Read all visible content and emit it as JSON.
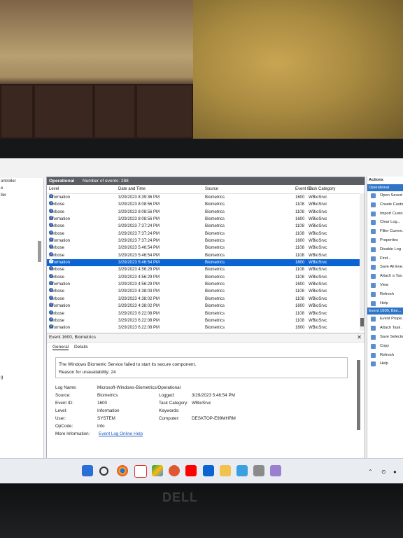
{
  "main": {
    "tab_title": "Operational",
    "event_count": "Number of events: 288",
    "columns": [
      "Level",
      "Date and Time",
      "Source",
      "Event ID",
      "Task Category"
    ],
    "rows": [
      {
        "level": "Information",
        "date": "3/29/2023 8:39:36 PM",
        "source": "Biometrics",
        "id": "1600",
        "cat": "WBioSrvc"
      },
      {
        "level": "Verbose",
        "date": "3/29/2023 8:08:56 PM",
        "source": "Biometrics",
        "id": "1108",
        "cat": "WBioSrvc"
      },
      {
        "level": "Verbose",
        "date": "3/29/2023 8:08:56 PM",
        "source": "Biometrics",
        "id": "1108",
        "cat": "WBioSrvc"
      },
      {
        "level": "Information",
        "date": "3/29/2023 8:08:56 PM",
        "source": "Biometrics",
        "id": "1600",
        "cat": "WBioSrvc"
      },
      {
        "level": "Verbose",
        "date": "3/29/2023 7:37:24 PM",
        "source": "Biometrics",
        "id": "1108",
        "cat": "WBioSrvc"
      },
      {
        "level": "Verbose",
        "date": "3/29/2023 7:37:24 PM",
        "source": "Biometrics",
        "id": "1108",
        "cat": "WBioSrvc"
      },
      {
        "level": "Information",
        "date": "3/29/2023 7:37:24 PM",
        "source": "Biometrics",
        "id": "1600",
        "cat": "WBioSrvc"
      },
      {
        "level": "Verbose",
        "date": "3/29/2023 5:46:54 PM",
        "source": "Biometrics",
        "id": "1108",
        "cat": "WBioSrvc"
      },
      {
        "level": "Verbose",
        "date": "3/29/2023 5:46:54 PM",
        "source": "Biometrics",
        "id": "1108",
        "cat": "WBioSrvc"
      },
      {
        "level": "Information",
        "date": "3/29/2023 5:46:54 PM",
        "source": "Biometrics",
        "id": "1600",
        "cat": "WBioSrvc"
      },
      {
        "level": "Verbose",
        "date": "3/29/2023 4:56:29 PM",
        "source": "Biometrics",
        "id": "1108",
        "cat": "WBioSrvc"
      },
      {
        "level": "Verbose",
        "date": "3/29/2023 4:56:29 PM",
        "source": "Biometrics",
        "id": "1108",
        "cat": "WBioSrvc"
      },
      {
        "level": "Information",
        "date": "3/29/2023 4:56:29 PM",
        "source": "Biometrics",
        "id": "1600",
        "cat": "WBioSrvc"
      },
      {
        "level": "Verbose",
        "date": "3/29/2023 4:38:03 PM",
        "source": "Biometrics",
        "id": "1108",
        "cat": "WBioSrvc"
      },
      {
        "level": "Verbose",
        "date": "3/29/2023 4:38:02 PM",
        "source": "Biometrics",
        "id": "1108",
        "cat": "WBioSrvc"
      },
      {
        "level": "Information",
        "date": "3/29/2023 4:38:02 PM",
        "source": "Biometrics",
        "id": "1600",
        "cat": "WBioSrvc"
      },
      {
        "level": "Verbose",
        "date": "3/29/2023 6:22:08 PM",
        "source": "Biometrics",
        "id": "1108",
        "cat": "WBioSrvc"
      },
      {
        "level": "Verbose",
        "date": "3/29/2023 6:22:08 PM",
        "source": "Biometrics",
        "id": "1108",
        "cat": "WBioSrvc"
      },
      {
        "level": "Information",
        "date": "3/29/2023 6:22:08 PM",
        "source": "Biometrics",
        "id": "1600",
        "cat": "WBioSrvc"
      }
    ],
    "selected_index": 9
  },
  "left_nav": [
    "ontroller",
    "e",
    "ller"
  ],
  "detail": {
    "title": "Event 1600, Biometrics",
    "tabs": [
      "General",
      "Details"
    ],
    "message": "The Windows Biometric Service failed to start its secure component.",
    "reason": "Reason for unavailability: 24",
    "props": {
      "log_name_label": "Log Name:",
      "log_name": "Microsoft-Windows-Biometrics/Operational",
      "source_label": "Source:",
      "source": "Biometrics",
      "logged_label": "Logged:",
      "logged": "3/29/2023 5:46:54 PM",
      "event_id_label": "Event ID:",
      "event_id": "1600",
      "task_cat_label": "Task Category:",
      "task_cat": "WBioSrvc",
      "level_label": "Level:",
      "level": "Information",
      "keywords_label": "Keywords:",
      "user_label": "User:",
      "user": "SYSTEM",
      "computer_label": "Computer:",
      "computer": "DESKTOP-E99MHRM",
      "opcode_label": "OpCode:",
      "opcode": "Info",
      "more_info_label": "More Information:",
      "more_info": "Event Log Online Help"
    },
    "left_edge_char": "g"
  },
  "actions": {
    "header": "Actions",
    "section1": "Operational",
    "items1": [
      "Open Saved ...",
      "Create Custo...",
      "Import Custo...",
      "Clear Log...",
      "Filter Curren...",
      "Properties",
      "Disable Log",
      "Find...",
      "Save All Eve...",
      "Attach a Tas...",
      "View",
      "Refresh",
      "Help"
    ],
    "section2": "Event 1600, Bior...",
    "items2": [
      "Event Prope...",
      "Attach Task ...",
      "Save Selecte...",
      "Copy",
      "Refresh",
      "Help"
    ]
  },
  "taskbar": {
    "icons": [
      "windows-start",
      "search",
      "chrome",
      "gmail",
      "google-drive",
      "duckduckgo",
      "youtube",
      "outlook",
      "file-explorer",
      "remote-desktop",
      "printer",
      "phone-link"
    ],
    "colors": {
      "accent": "#0a64d4",
      "header": "#5a5d61",
      "actions_section": "#2e74c7"
    }
  },
  "bezel": {
    "brand": "DELL"
  }
}
